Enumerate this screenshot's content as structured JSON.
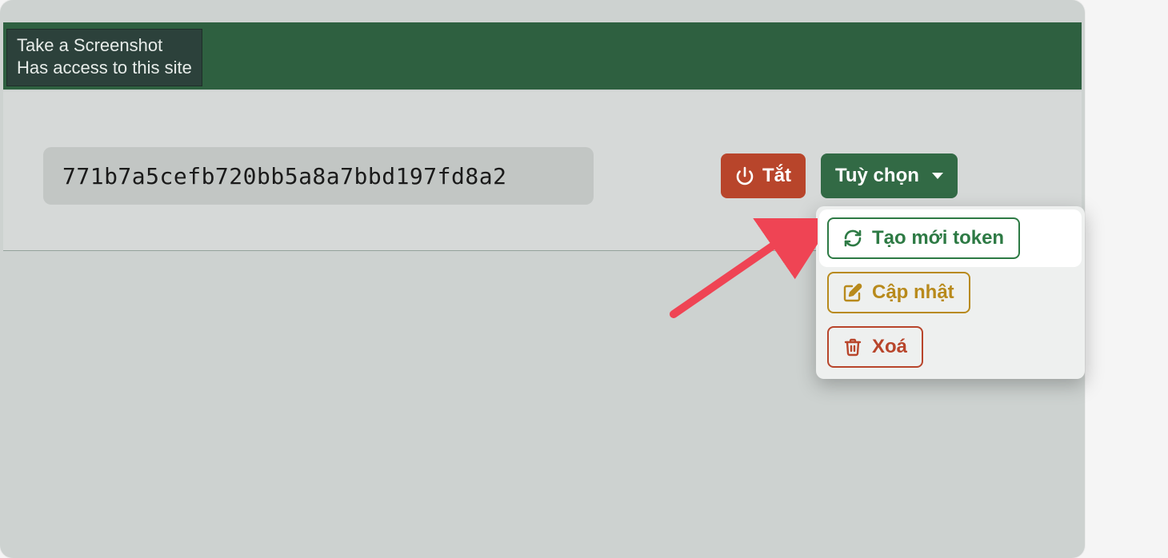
{
  "extension_tooltip": {
    "line1": "Take a Screenshot",
    "line2": "Has access to this site"
  },
  "token": {
    "value": "771b7a5cefb720bb5a8a7bbd197fd8a2"
  },
  "buttons": {
    "off_label": "Tắt",
    "options_label": "Tuỳ chọn"
  },
  "dropdown": {
    "regenerate_label": "Tạo mới token",
    "update_label": "Cập nhật",
    "delete_label": "Xoá"
  },
  "colors": {
    "header_green": "#2e6040",
    "danger": "#b8452b",
    "success": "#326a45",
    "warning": "#b88a1c"
  }
}
